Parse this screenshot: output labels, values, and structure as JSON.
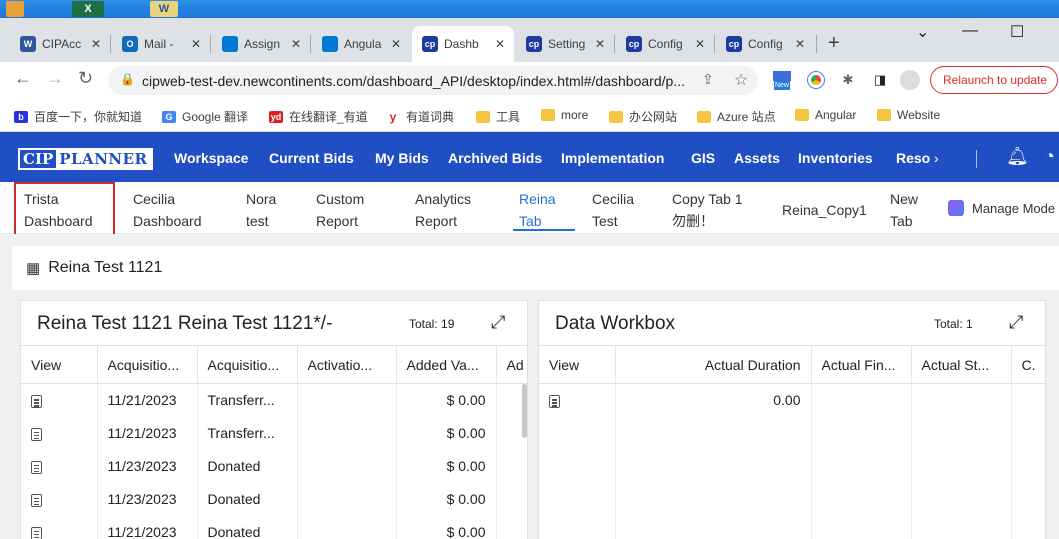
{
  "browser": {
    "tabs": [
      {
        "title": "CIPAcc",
        "icon": "word-icon",
        "color": "#2b579a",
        "glyph": "W"
      },
      {
        "title": "Mail -",
        "icon": "outlook-icon",
        "color": "#0f6cbd",
        "glyph": "O"
      },
      {
        "title": "Assign",
        "icon": "azure-devops-icon",
        "color": "#0078d4",
        "glyph": ""
      },
      {
        "title": "Angula",
        "icon": "azure-devops-icon",
        "color": "#0078d4",
        "glyph": ""
      },
      {
        "title": "Dashb",
        "icon": "cip-icon",
        "color": "#1f3aa0",
        "glyph": "cp"
      },
      {
        "title": "Setting",
        "icon": "cip-icon",
        "color": "#1f3aa0",
        "glyph": "cp"
      },
      {
        "title": "Config",
        "icon": "cip-icon",
        "color": "#1f3aa0",
        "glyph": "cp"
      },
      {
        "title": "Config",
        "icon": "cip-icon",
        "color": "#1f3aa0",
        "glyph": "cp"
      }
    ],
    "active_tab_index": 4,
    "url": "cipweb-test-dev.newcontinents.com/dashboard_API/desktop/index.html#/dashboard/p...",
    "relaunch_label": "Relaunch to update",
    "new_badge": "New",
    "bookmarks": [
      {
        "label": "百度一下，你就知道",
        "icon": "baidu-icon"
      },
      {
        "label": "Google 翻译",
        "icon": "google-translate-icon"
      },
      {
        "label": "在线翻译_有道",
        "icon": "youdao-icon"
      },
      {
        "label": "有道词典",
        "icon": "youdao-dict-icon"
      },
      {
        "label": "工具",
        "icon": "folder-icon"
      },
      {
        "label": "more",
        "icon": "folder-icon"
      },
      {
        "label": "办公网站",
        "icon": "folder-icon"
      },
      {
        "label": "Azure 站点",
        "icon": "folder-icon"
      },
      {
        "label": "Angular",
        "icon": "folder-icon"
      },
      {
        "label": "Website",
        "icon": "folder-icon"
      }
    ]
  },
  "app": {
    "logo_cip": "CIP",
    "logo_planner": "PLANNER",
    "nav": [
      "Workspace",
      "Current Bids",
      "My Bids",
      "Archived Bids",
      "Implementation",
      "GIS",
      "Assets",
      "Inventories",
      "Reso"
    ],
    "dashboard_tabs": [
      {
        "line1": "Trista",
        "line2": "Dashboard"
      },
      {
        "line1": "Cecilia",
        "line2": "Dashboard"
      },
      {
        "line1": "Nora",
        "line2": "test"
      },
      {
        "line1": "Custom",
        "line2": "Report"
      },
      {
        "line1": "Analytics",
        "line2": "Report"
      },
      {
        "line1": "Reina",
        "line2": "Tab"
      },
      {
        "line1": "Cecilia",
        "line2": "Test"
      },
      {
        "line1": "Copy Tab 1",
        "line2": "勿删！"
      },
      {
        "line1": "Reina_Copy1",
        "line2": ""
      },
      {
        "line1": "New",
        "line2": "Tab"
      }
    ],
    "active_dashboard_tab_index": 5,
    "manage_label": "Manage Mode",
    "page_title": "Reina Test 1121"
  },
  "cards": {
    "left": {
      "title": "Reina Test 1121 Reina Test 1121*/-",
      "total": "Total: 19",
      "columns": [
        "View",
        "Acquisitio...",
        "Acquisitio...",
        "Activatio...",
        "Added Va...",
        "Ad"
      ],
      "rows": [
        {
          "date": "11/21/2023",
          "type": "Transferr...",
          "activation": "",
          "added": "$ 0.00"
        },
        {
          "date": "11/21/2023",
          "type": "Transferr...",
          "activation": "",
          "added": "$ 0.00"
        },
        {
          "date": "11/23/2023",
          "type": "Donated",
          "activation": "",
          "added": "$ 0.00"
        },
        {
          "date": "11/23/2023",
          "type": "Donated",
          "activation": "",
          "added": "$ 0.00"
        },
        {
          "date": "11/21/2023",
          "type": "Donated",
          "activation": "",
          "added": "$ 0.00"
        }
      ]
    },
    "right": {
      "title": "Data Workbox",
      "total": "Total: 1",
      "columns": [
        "View",
        "Actual Duration",
        "Actual Fin...",
        "Actual St...",
        "C."
      ],
      "rows": [
        {
          "duration": "0.00",
          "finish": "",
          "start": "",
          "c": ""
        }
      ]
    }
  }
}
